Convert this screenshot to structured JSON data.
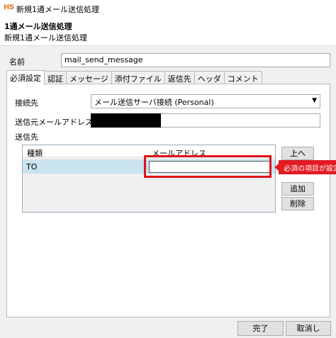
{
  "window": {
    "app_icon_text": "HS",
    "title": "新規1通メール送信処理"
  },
  "header": {
    "title": "1通メール送信処理",
    "subtitle": "新規1通メール送信処理"
  },
  "name_field": {
    "label": "名前",
    "value": "mail_send_message"
  },
  "tabs": [
    {
      "label": "必須設定",
      "active": true
    },
    {
      "label": "認証",
      "active": false
    },
    {
      "label": "メッセージ",
      "active": false
    },
    {
      "label": "添付ファイル",
      "active": false
    },
    {
      "label": "返信先",
      "active": false
    },
    {
      "label": "ヘッダ",
      "active": false
    },
    {
      "label": "コメント",
      "active": false
    }
  ],
  "required": {
    "connection_label": "接続先",
    "connection_value": "メール送信サーバ接続 (Personal)",
    "from_label": "送信元メールアドレス",
    "to_label": "送信先",
    "list": {
      "col_type": "種類",
      "col_address": "メールアドレス",
      "rows": [
        {
          "type": "TO",
          "address": ""
        }
      ]
    },
    "buttons": {
      "up": "上へ",
      "add": "追加",
      "delete": "削除"
    },
    "tooltip": "必須の項目が設定"
  },
  "footer": {
    "ok": "完了",
    "cancel": "取消し"
  },
  "colors": {
    "highlight": "#e0121b",
    "selected_row": "#c9e3ef",
    "tooltip_bg": "#e21a22"
  }
}
